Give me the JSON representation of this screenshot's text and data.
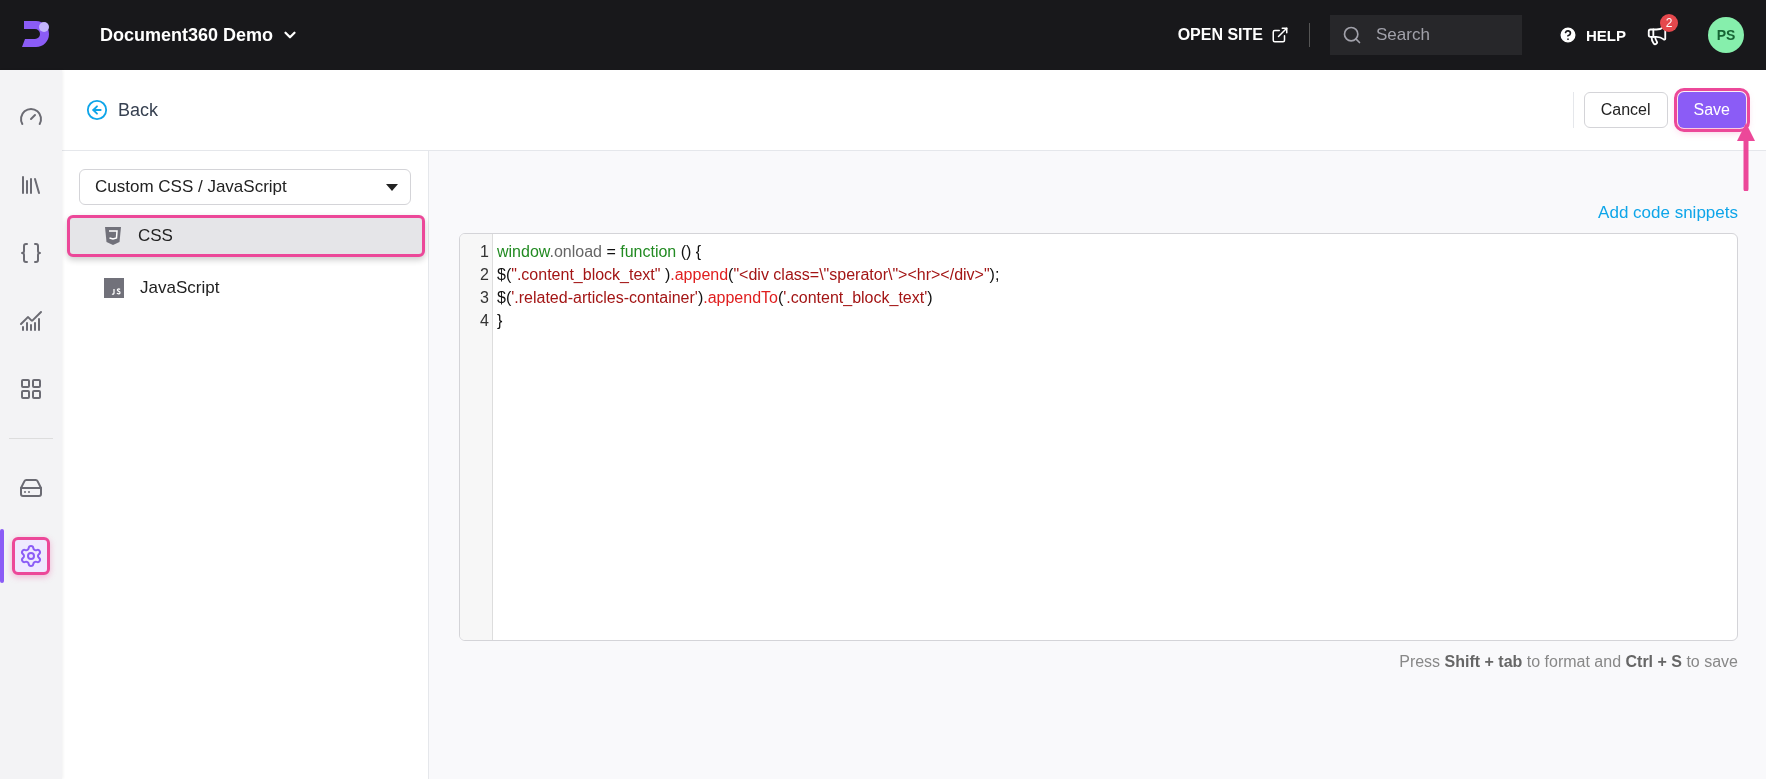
{
  "header": {
    "workspace": "Document360 Demo",
    "open_site": "OPEN SITE",
    "search": {
      "placeholder": "Search"
    },
    "help": "HELP",
    "notifications": "2",
    "avatar": "PS"
  },
  "rail": [
    {
      "kind": "gauge",
      "selected": false,
      "highlighted": false
    },
    {
      "kind": "books",
      "selected": false,
      "highlighted": false
    },
    {
      "kind": "braces",
      "selected": false,
      "highlighted": false
    },
    {
      "kind": "chart",
      "selected": false,
      "highlighted": false
    },
    {
      "kind": "grid",
      "selected": false,
      "highlighted": false
    },
    {
      "kind": "divider"
    },
    {
      "kind": "drive",
      "selected": false,
      "highlighted": false
    },
    {
      "kind": "gear",
      "selected": true,
      "highlighted": true
    }
  ],
  "toolbar": {
    "back": "Back",
    "cancel": "Cancel",
    "save": "Save",
    "save_highlighted": true
  },
  "panel": {
    "dropdown": "Custom CSS / JavaScript",
    "items": [
      {
        "kind": "css",
        "label": "CSS",
        "selected": true,
        "highlighted": true
      },
      {
        "kind": "js",
        "label": "JavaScript",
        "selected": false,
        "highlighted": false
      }
    ]
  },
  "editor": {
    "add_snippets": "Add code snippets",
    "lines": [
      {
        "number": "1",
        "tokens": [
          {
            "kind": "keyword",
            "text": "window"
          },
          {
            "kind": "property",
            "text": ".onload"
          },
          {
            "kind": "plain",
            "text": " = "
          },
          {
            "kind": "keyword",
            "text": "function"
          },
          {
            "kind": "plain",
            "text": " () {"
          }
        ]
      },
      {
        "number": "2",
        "tokens": [
          {
            "kind": "plain",
            "text": "$("
          },
          {
            "kind": "string",
            "text": "\".content_block_text\""
          },
          {
            "kind": "plain",
            "text": " )"
          },
          {
            "kind": "method",
            "text": ".append"
          },
          {
            "kind": "plain",
            "text": "("
          },
          {
            "kind": "string",
            "text": "\"<div class=\\\"sperator\\\"><hr></div>\""
          },
          {
            "kind": "plain",
            "text": ");"
          }
        ]
      },
      {
        "number": "3",
        "tokens": [
          {
            "kind": "plain",
            "text": "$("
          },
          {
            "kind": "string",
            "text": "'.related-articles-container'"
          },
          {
            "kind": "plain",
            "text": ")"
          },
          {
            "kind": "method",
            "text": ".appendTo"
          },
          {
            "kind": "plain",
            "text": "("
          },
          {
            "kind": "string",
            "text": "'.content_block_text'"
          },
          {
            "kind": "plain",
            "text": ")"
          }
        ]
      },
      {
        "number": "4",
        "tokens": [
          {
            "kind": "plain",
            "text": "}"
          }
        ]
      }
    ],
    "hint": "Press **Shift + tab** to format and **Ctrl + S** to save"
  }
}
